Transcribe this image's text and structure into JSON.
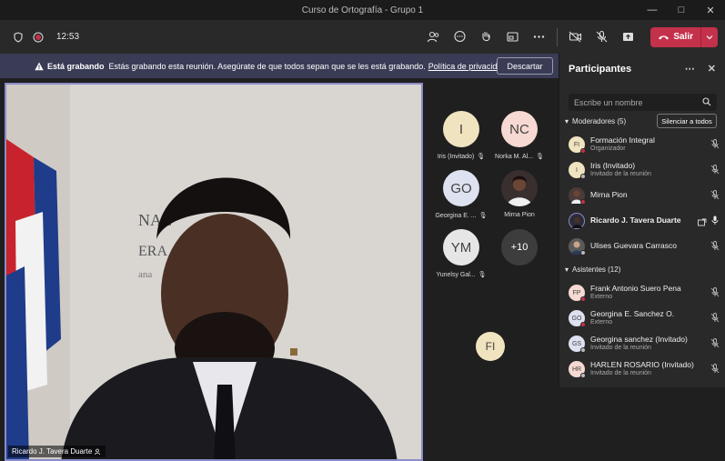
{
  "window": {
    "title": "Curso de Ortografía - Grupo 1"
  },
  "toolbar": {
    "time": "12:53",
    "leave_label": "Salir"
  },
  "banner": {
    "title": "Está grabando",
    "message": "Estás grabando esta reunión. Asegúrate de que todos sepan que se les está grabando.",
    "link": "Política de privacidad",
    "dismiss": "Descartar"
  },
  "video": {
    "speaker": "Ricardo J. Tavera Duarte"
  },
  "tiles": [
    {
      "initials": "I",
      "name": "Iris (Invitado)",
      "color": "#f0e3c0"
    },
    {
      "initials": "NC",
      "name": "Norka M. Al...",
      "color": "#f6d9d2"
    },
    {
      "initials": "GO",
      "name": "Georgina E. ...",
      "color": "#dde1f0"
    },
    {
      "initials": "",
      "name": "Mirna Pion",
      "color": "#3a2f2f"
    },
    {
      "initials": "YM",
      "name": "Yunelsy Gal...",
      "color": "#e6e6e6"
    },
    {
      "initials": "+10",
      "name": "",
      "color": "#3d3d3d"
    },
    {
      "initials": "FI",
      "name": "",
      "color": "#f0e3c0"
    }
  ],
  "panel": {
    "title": "Participantes",
    "search_placeholder": "Escribe un nombre",
    "moderators_label": "Moderadores (5)",
    "mute_all": "Silenciar a todos",
    "attendees_label": "Asistentes (12)"
  },
  "moderators": [
    {
      "initials": "FI",
      "name": "Formación Integral",
      "role": "Organizador",
      "color": "#f0e3c0"
    },
    {
      "initials": "I",
      "name": "Iris (Invitado)",
      "role": "Invitado de la reunión",
      "color": "#f0e3c0"
    },
    {
      "initials": "",
      "name": "Mirna Pion",
      "role": "",
      "color": "#4a3a3a"
    },
    {
      "initials": "",
      "name": "Ricardo J. Tavera Duarte",
      "role": "",
      "color": "#2b2b3a"
    },
    {
      "initials": "",
      "name": "Ulises Guevara Carrasco",
      "role": "",
      "color": "#5a5a5a"
    }
  ],
  "attendees": [
    {
      "initials": "FP",
      "name": "Frank Antonio Suero Pena",
      "role": "Externo",
      "color": "#f6d9d2"
    },
    {
      "initials": "GO",
      "name": "Georgina E. Sanchez O.",
      "role": "Externo",
      "color": "#dde1f0"
    },
    {
      "initials": "GS",
      "name": "Georgina sanchez (Invitado)",
      "role": "Invitado de la reunión",
      "color": "#dde1f0"
    },
    {
      "initials": "HR",
      "name": "HARLEN ROSARIO (Invitado)",
      "role": "Invitado de la reunión",
      "color": "#f6d9d2"
    }
  ],
  "colors": {
    "accent": "#8b8cc7",
    "leave": "#c4314b",
    "banner": "#3a3b55"
  }
}
